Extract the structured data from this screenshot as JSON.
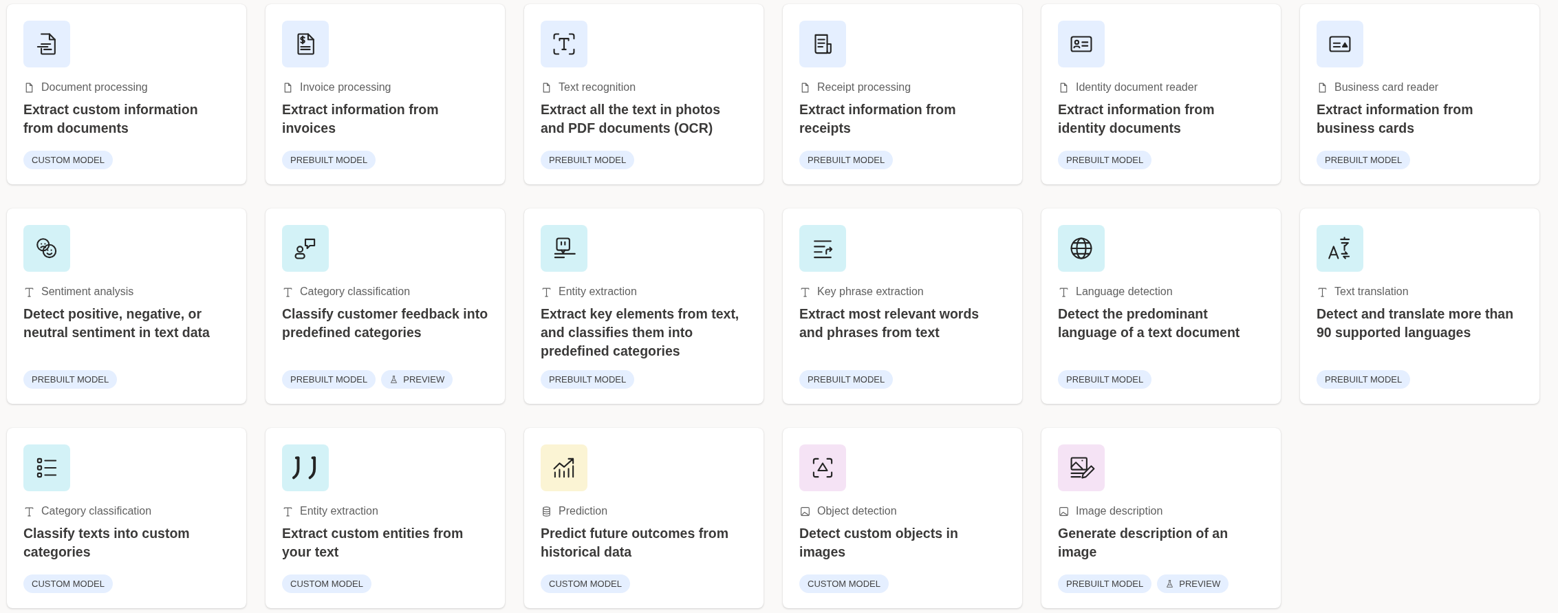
{
  "cards": [
    {
      "category": "Document processing",
      "kind": "document",
      "color": "#e5efff",
      "title": "Extract custom information from documents",
      "badges": [
        {
          "kind": "model",
          "label": "CUSTOM MODEL"
        }
      ]
    },
    {
      "category": "Invoice processing",
      "kind": "document",
      "color": "#e5efff",
      "title": "Extract information from invoices",
      "badges": [
        {
          "kind": "model",
          "label": "PREBUILT MODEL"
        }
      ]
    },
    {
      "category": "Text recognition",
      "kind": "document",
      "color": "#e5efff",
      "title": "Extract all the text in photos and PDF documents (OCR)",
      "badges": [
        {
          "kind": "model",
          "label": "PREBUILT MODEL"
        }
      ]
    },
    {
      "category": "Receipt processing",
      "kind": "document",
      "color": "#e5efff",
      "title": "Extract information from receipts",
      "badges": [
        {
          "kind": "model",
          "label": "PREBUILT MODEL"
        }
      ]
    },
    {
      "category": "Identity document reader",
      "kind": "document",
      "color": "#e5efff",
      "title": "Extract information from identity documents",
      "badges": [
        {
          "kind": "model",
          "label": "PREBUILT MODEL"
        }
      ]
    },
    {
      "category": "Business card reader",
      "kind": "document",
      "color": "#e5efff",
      "title": "Extract information from business cards",
      "badges": [
        {
          "kind": "model",
          "label": "PREBUILT MODEL"
        }
      ]
    },
    {
      "category": "Sentiment analysis",
      "kind": "text",
      "color": "#d3f2f7",
      "title": "Detect positive, negative, or neutral sentiment in text data",
      "badges": [
        {
          "kind": "model",
          "label": "PREBUILT MODEL"
        }
      ]
    },
    {
      "category": "Category classification",
      "kind": "text",
      "color": "#d3f2f7",
      "title": "Classify customer feedback into predefined categories",
      "badges": [
        {
          "kind": "model",
          "label": "PREBUILT MODEL"
        },
        {
          "kind": "preview",
          "label": "PREVIEW"
        }
      ]
    },
    {
      "category": "Entity extraction",
      "kind": "text",
      "color": "#d3f2f7",
      "title": "Extract key elements from text, and classifies them into predefined categories",
      "badges": [
        {
          "kind": "model",
          "label": "PREBUILT MODEL"
        }
      ]
    },
    {
      "category": "Key phrase extraction",
      "kind": "text",
      "color": "#d3f2f7",
      "title": "Extract most relevant words and phrases from text",
      "badges": [
        {
          "kind": "model",
          "label": "PREBUILT MODEL"
        }
      ]
    },
    {
      "category": "Language detection",
      "kind": "text",
      "color": "#d3f2f7",
      "title": "Detect the predominant language of a text document",
      "badges": [
        {
          "kind": "model",
          "label": "PREBUILT MODEL"
        }
      ]
    },
    {
      "category": "Text translation",
      "kind": "text",
      "color": "#d3f2f7",
      "title": "Detect and translate more than 90 supported languages",
      "badges": [
        {
          "kind": "model",
          "label": "PREBUILT MODEL"
        }
      ]
    },
    {
      "category": "Category classification",
      "kind": "text",
      "color": "#d3f2f7",
      "title": "Classify texts into custom categories",
      "badges": [
        {
          "kind": "model",
          "label": "CUSTOM MODEL"
        }
      ]
    },
    {
      "category": "Entity extraction",
      "kind": "text",
      "color": "#d3f2f7",
      "title": "Extract custom entities from your text",
      "badges": [
        {
          "kind": "model",
          "label": "CUSTOM MODEL"
        }
      ]
    },
    {
      "category": "Prediction",
      "kind": "data",
      "color": "#fbf4d4",
      "title": "Predict future outcomes from historical data",
      "badges": [
        {
          "kind": "model",
          "label": "CUSTOM MODEL"
        }
      ]
    },
    {
      "category": "Object detection",
      "kind": "image",
      "color": "#f5e3f5",
      "title": "Detect custom objects in images",
      "badges": [
        {
          "kind": "model",
          "label": "CUSTOM MODEL"
        }
      ]
    },
    {
      "category": "Image description",
      "kind": "image",
      "color": "#f5e3f5",
      "title": "Generate description of an image",
      "badges": [
        {
          "kind": "model",
          "label": "PREBUILT MODEL"
        },
        {
          "kind": "preview",
          "label": "PREVIEW"
        }
      ]
    }
  ]
}
